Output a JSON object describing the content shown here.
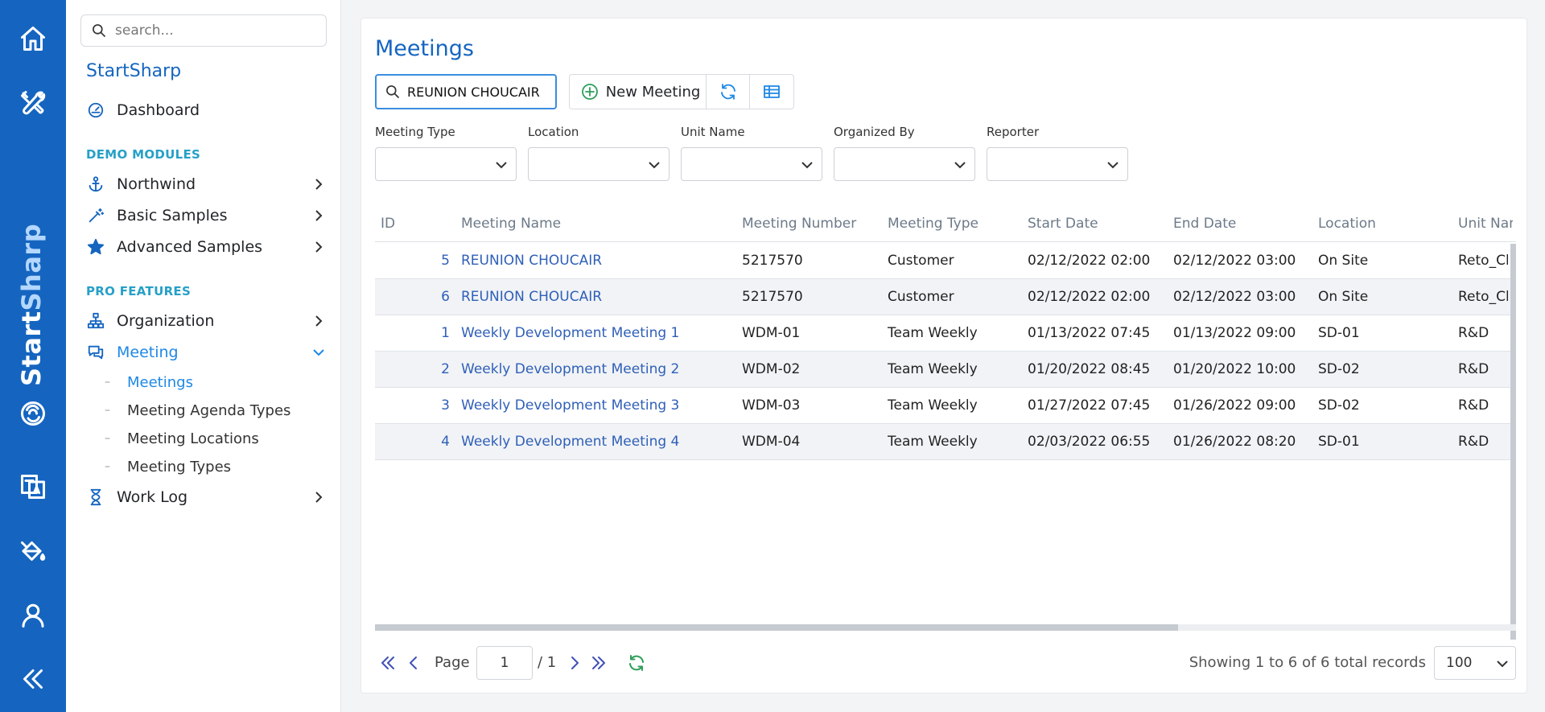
{
  "app": {
    "brand_start": "Start",
    "brand_sharp": "Sharp"
  },
  "sidebar": {
    "search_placeholder": "search...",
    "title": "StartSharp",
    "dashboard": "Dashboard",
    "demo_section": "DEMO MODULES",
    "northwind": "Northwind",
    "basic_samples": "Basic Samples",
    "advanced_samples": "Advanced Samples",
    "pro_section": "PRO FEATURES",
    "organization": "Organization",
    "meeting": "Meeting",
    "meeting_children": [
      "Meetings",
      "Meeting Agenda Types",
      "Meeting Locations",
      "Meeting Types"
    ],
    "work_log": "Work Log"
  },
  "main": {
    "title": "Meetings",
    "quick_search_value": "REUNION CHOUCAIR",
    "new_button": "New Meeting",
    "filters": {
      "meeting_type": "Meeting Type",
      "location": "Location",
      "unit_name": "Unit Name",
      "organized_by": "Organized By",
      "reporter": "Reporter"
    }
  },
  "grid": {
    "columns": [
      "ID",
      "Meeting Name",
      "Meeting Number",
      "Meeting Type",
      "Start Date",
      "End Date",
      "Location",
      "Unit Name"
    ],
    "rows": [
      [
        "5",
        "REUNION CHOUCAIR",
        "5217570",
        "Customer",
        "02/12/2022 02:00",
        "02/12/2022 03:00",
        "On Site",
        "Reto_Cl"
      ],
      [
        "6",
        "REUNION CHOUCAIR",
        "5217570",
        "Customer",
        "02/12/2022 02:00",
        "02/12/2022 03:00",
        "On Site",
        "Reto_Cl"
      ],
      [
        "1",
        "Weekly Development Meeting 1",
        "WDM-01",
        "Team Weekly",
        "01/13/2022 07:45",
        "01/13/2022 09:00",
        "SD-01",
        "R&D"
      ],
      [
        "2",
        "Weekly Development Meeting 2",
        "WDM-02",
        "Team Weekly",
        "01/20/2022 08:45",
        "01/20/2022 10:00",
        "SD-02",
        "R&D"
      ],
      [
        "3",
        "Weekly Development Meeting 3",
        "WDM-03",
        "Team Weekly",
        "01/27/2022 07:45",
        "01/26/2022 09:00",
        "SD-02",
        "R&D"
      ],
      [
        "4",
        "Weekly Development Meeting 4",
        "WDM-04",
        "Team Weekly",
        "02/03/2022 06:55",
        "01/26/2022 08:20",
        "SD-01",
        "R&D"
      ]
    ]
  },
  "pager": {
    "page_label": "Page",
    "page_value": "1",
    "page_total": "/ 1",
    "info": "Showing 1 to 6 of 6 total records",
    "page_size": "100"
  },
  "icons": {
    "rail": [
      "home-icon",
      "tools-icon",
      "translate-icon",
      "paint-bucket-icon",
      "user-icon",
      "collapse-icon"
    ],
    "accent": "#1565c0"
  }
}
